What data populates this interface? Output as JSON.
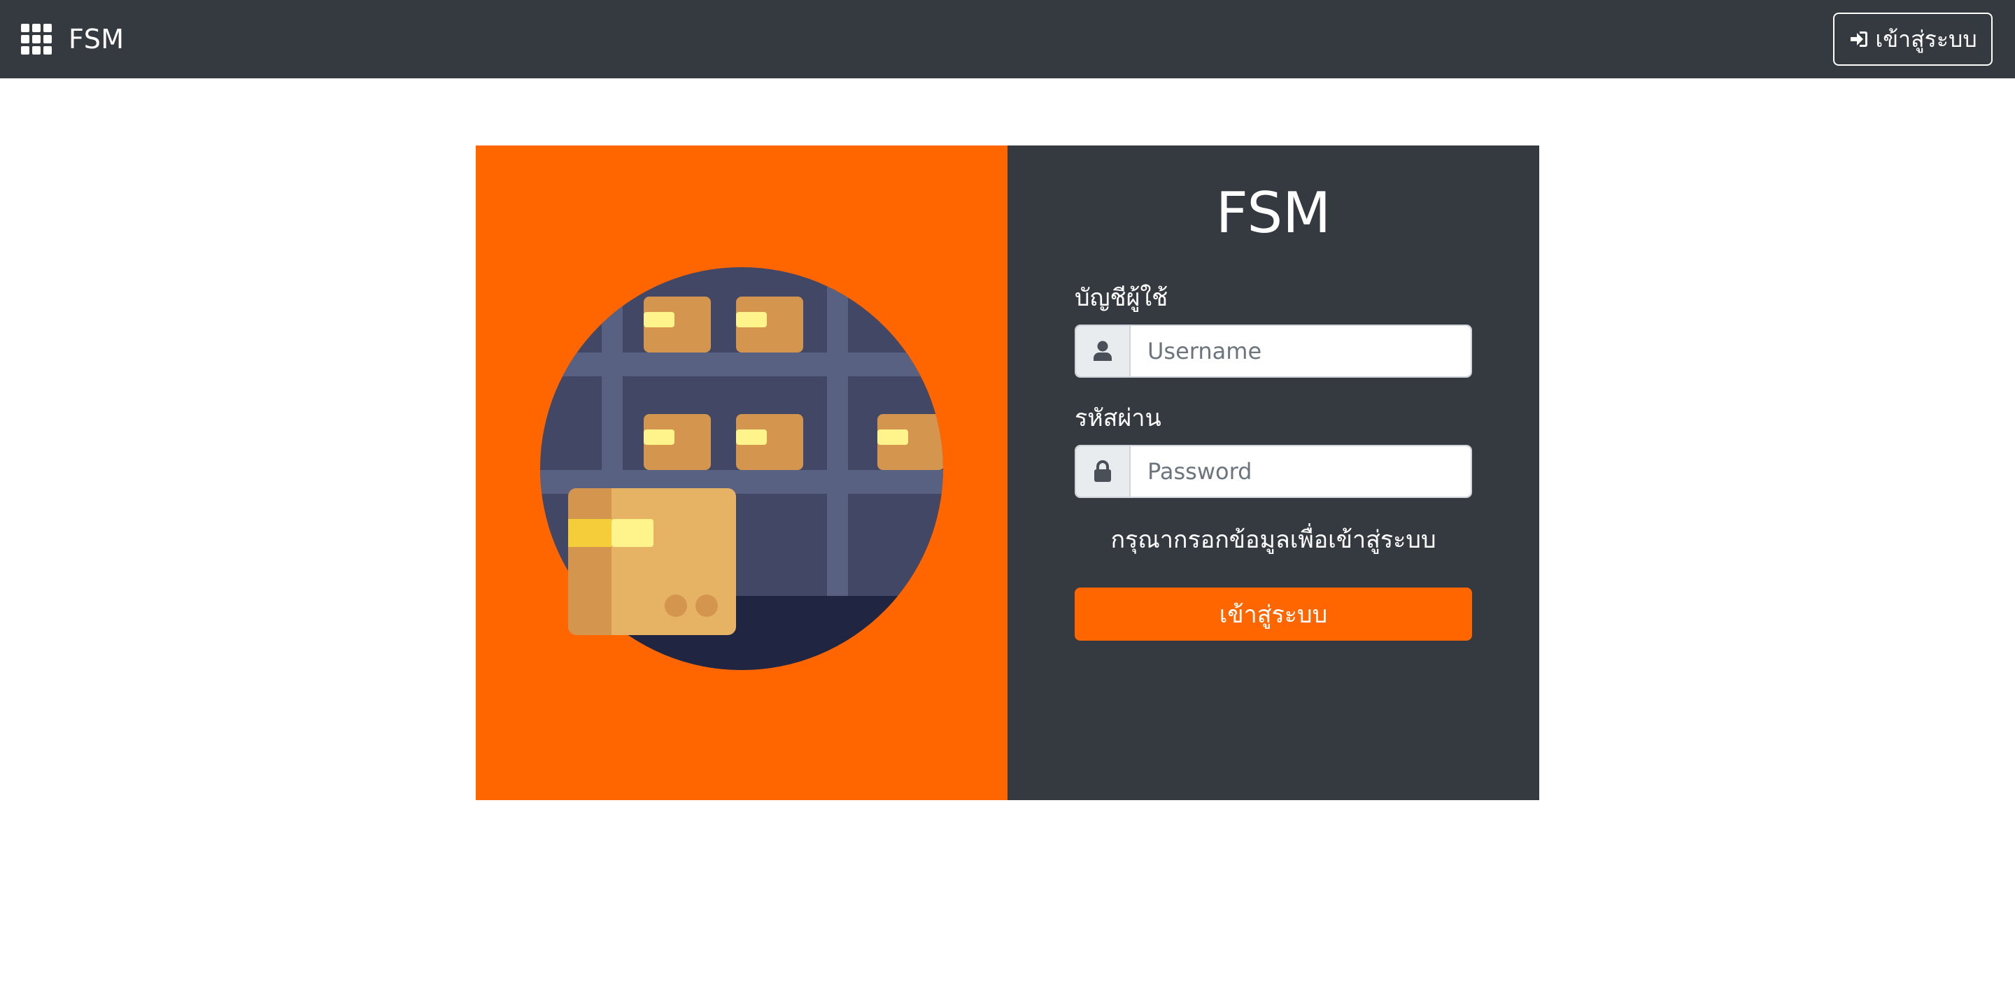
{
  "navbar": {
    "brand": "FSM",
    "login_button": "เข้าสู่ระบบ",
    "menu_icon": "grid-icon",
    "login_icon": "sign-in-icon"
  },
  "login": {
    "title": "FSM",
    "username_label": "บัญชีผู้ใช้",
    "username_placeholder": "Username",
    "username_value": "",
    "username_icon": "user-icon",
    "password_label": "รหัสผ่าน",
    "password_placeholder": "Password",
    "password_value": "",
    "password_icon": "lock-icon",
    "hint": "กรุณากรอกข้อมูลเพื่อเข้าสู่ระบบ",
    "submit": "เข้าสู่ระบบ"
  },
  "colors": {
    "accent": "#ff6600",
    "dark_panel": "#353a41",
    "navbar": "#353a41"
  }
}
